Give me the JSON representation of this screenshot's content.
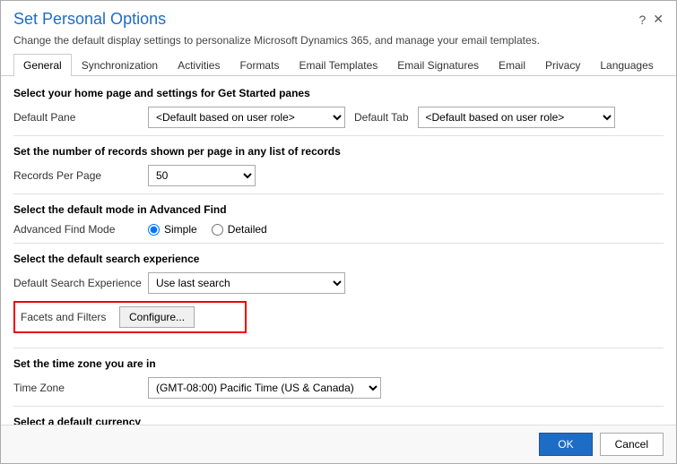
{
  "dialog": {
    "title": "Set Personal Options",
    "subtitle": "Change the default display settings to personalize Microsoft Dynamics 365, and manage your email templates.",
    "help_icon": "?",
    "close_icon": "✕"
  },
  "tabs": [
    {
      "label": "General",
      "active": true
    },
    {
      "label": "Synchronization",
      "active": false
    },
    {
      "label": "Activities",
      "active": false
    },
    {
      "label": "Formats",
      "active": false
    },
    {
      "label": "Email Templates",
      "active": false
    },
    {
      "label": "Email Signatures",
      "active": false
    },
    {
      "label": "Email",
      "active": false
    },
    {
      "label": "Privacy",
      "active": false
    },
    {
      "label": "Languages",
      "active": false
    }
  ],
  "sections": {
    "home_page": {
      "title": "Select your home page and settings for Get Started panes",
      "default_pane_label": "Default Pane",
      "default_pane_value": "<Default based on user role>",
      "default_tab_label": "Default Tab",
      "default_tab_value": "<Default based on user role>"
    },
    "records": {
      "title": "Set the number of records shown per page in any list of records",
      "label": "Records Per Page",
      "value": "50"
    },
    "advanced_find": {
      "title": "Select the default mode in Advanced Find",
      "label": "Advanced Find Mode",
      "options": [
        {
          "label": "Simple",
          "checked": true
        },
        {
          "label": "Detailed",
          "checked": false
        }
      ]
    },
    "search": {
      "title": "Select the default search experience",
      "label": "Default Search Experience",
      "value": "Use last search"
    },
    "facets": {
      "label": "Facets and Filters",
      "button": "Configure..."
    },
    "timezone": {
      "title": "Set the time zone you are in",
      "label": "Time Zone",
      "value": "(GMT-08:00) Pacific Time (US & Canada)"
    },
    "currency": {
      "title": "Select a default currency"
    }
  },
  "footer": {
    "ok_label": "OK",
    "cancel_label": "Cancel"
  }
}
